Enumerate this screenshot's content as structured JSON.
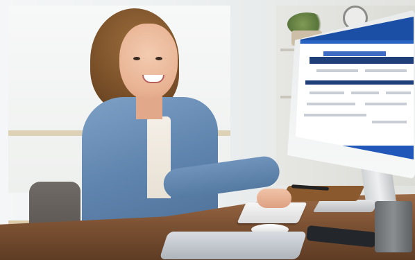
{
  "scene": {
    "description_tag": "",
    "colors": {
      "denim": "#5f84ad",
      "desk_wood": "#7d5234",
      "screen_accent": "#1b4fa6",
      "background": "#eef1f2"
    },
    "icons": [
      "monitor-icon",
      "keyboard-icon",
      "mouse-icon",
      "phone-icon",
      "tablet-icon",
      "plant-icon",
      "clock-icon"
    ]
  }
}
